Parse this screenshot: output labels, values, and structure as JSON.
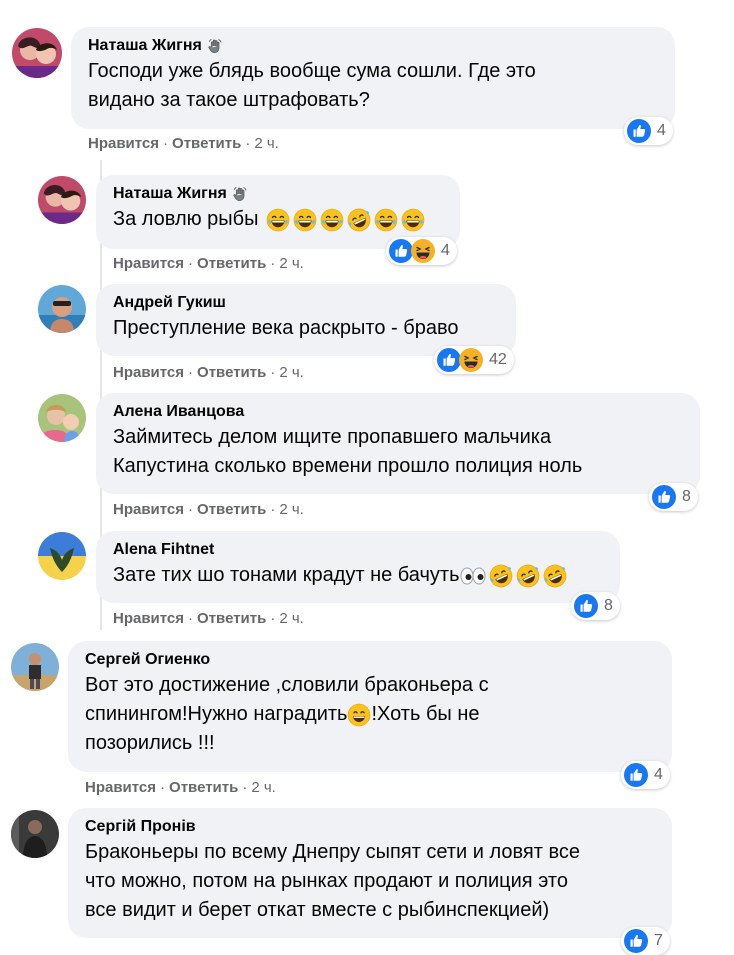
{
  "actions": {
    "like": "Нравится",
    "reply": "Ответить",
    "dot": "·"
  },
  "comments": [
    {
      "name": "Наташа Жигня",
      "lines": [
        "Господи уже блядь вообще сума сошли. Где это",
        "видано за такое штрафовать?"
      ],
      "time": "2 ч.",
      "reactions": "4",
      "icons": [
        "like-icon"
      ]
    },
    {
      "name": "Наташа Жигня",
      "text": "За ловлю рыбы",
      "time": "2 ч.",
      "reactions": "4",
      "icons": [
        "like-icon",
        "haha-icon"
      ]
    },
    {
      "name": "Андрей Гукиш",
      "text": "Преступление века раскрыто - браво",
      "time": "2 ч.",
      "reactions": "42",
      "icons": [
        "like-icon",
        "haha-icon"
      ]
    },
    {
      "name": "Алена Иванцова",
      "lines": [
        "Займитесь делом ищите пропавшего мальчика",
        "Капустина сколько времени прошло полиция ноль"
      ],
      "time": "2 ч.",
      "reactions": "8",
      "icons": [
        "like-icon"
      ]
    },
    {
      "name": "Alena Fihtnet",
      "text": "Зате тих шо тонами крадут не бачуть",
      "time": "2 ч.",
      "reactions": "8",
      "icons": [
        "like-icon"
      ]
    },
    {
      "name": "Сергей Огиенко",
      "lines": [
        "Вот это достижение ,словили браконьера с",
        "спинингом!Нужно наградить",
        "!Хоть бы не",
        "позорились !!!"
      ],
      "time": "2 ч.",
      "reactions": "4",
      "icons": [
        "like-icon"
      ]
    },
    {
      "name": "Сергій Пронів",
      "lines": [
        "Браконьеры по всему Днепру сыпят сети и ловят все",
        "что можно, потом на рынках продают и полиция это",
        "все видит и берет откат вместе с рыбинспекцией)"
      ],
      "reactions": "7",
      "icons": [
        "like-icon"
      ]
    }
  ],
  "colors": {
    "like_blue": "#1877f2",
    "haha_yellow": "#f7b125",
    "bubble": "#f0f2f5",
    "meta": "#65676b"
  }
}
